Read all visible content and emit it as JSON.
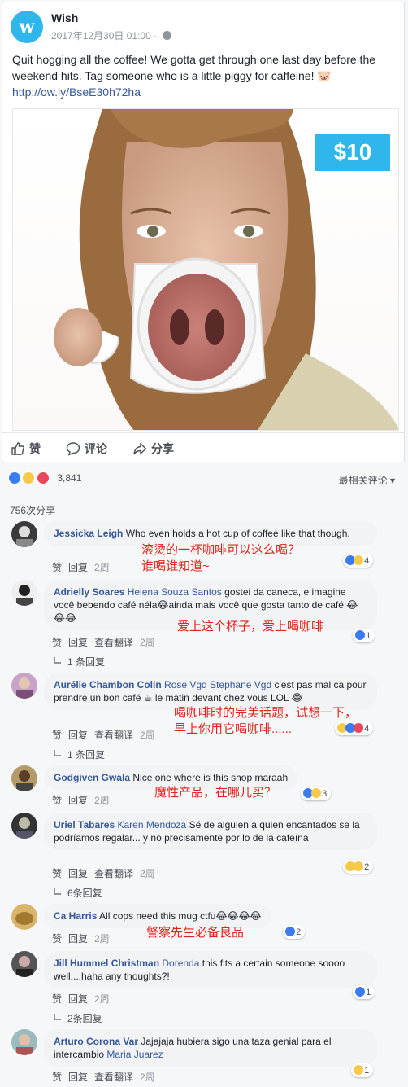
{
  "post": {
    "page_name": "Wish",
    "date": "2017年12月30日 01:00 · ",
    "text": "Quit hogging all the coffee! We gotta get through one last day before the weekend hits. Tag someone who is a little piggy for caffeine! 🐷",
    "link": "http://ow.ly/BseE30h72ha",
    "price_badge": "$10",
    "actions": {
      "like": "赞",
      "comment": "评论",
      "share": "分享"
    }
  },
  "reactions_count": "3,841",
  "sort_label": "最相关评论 ▾",
  "share_count": "756次分享",
  "comments": [
    {
      "author": "Jessicka Leigh",
      "text": "Who even holds a hot cup of coffee like that though.",
      "meta_like": "赞",
      "meta_reply": "回复",
      "time": "2周",
      "reactions": "4",
      "annotation": "滚烫的一杯咖啡可以这么喝？\n谁喝谁知道~"
    },
    {
      "author": "Adrielly Soares",
      "tag": "Helena Souza Santos",
      "text": " gostei da caneca, e imagine você bebendo café néla😂ainda mais você que gosta tanto de café 😂😂😂",
      "meta_like": "赞",
      "meta_reply": "回复",
      "meta_translate": "查看翻译",
      "time": "2周",
      "reactions": "1",
      "replies": "1 条回复",
      "annotation": "爱上这个杯子，爱上喝咖啡"
    },
    {
      "author": "Aurélie Chambon Colin",
      "tag": "Rose Vgd Stephane Vgd",
      "text": " c'est pas mal ca pour prendre un bon café ☕ le matin devant chez vous LOL 😂",
      "meta_like": "赞",
      "meta_reply": "回复",
      "meta_translate": "查看翻译",
      "time": "2周",
      "reactions": "4",
      "replies": "1 条回复",
      "annotation": "喝咖啡时的完美话题，试想一下，\n早上你用它喝咖啡......"
    },
    {
      "author": "Godgiven Gwala",
      "text": "Nice one where is this shop maraah",
      "meta_like": "赞",
      "meta_reply": "回复",
      "time": "2周",
      "reactions": "3",
      "annotation": "魔性产品，在哪儿买？"
    },
    {
      "author": "Uriel Tabares",
      "tag": "Karen Mendoza",
      "text": " Sé de alguien a quien encantados se la podríamos regalar... y no precisamente por lo de la cafeína",
      "meta_like": "赞",
      "meta_reply": "回复",
      "meta_translate": "查看翻译",
      "time": "2周",
      "reactions": "2",
      "replies": "6条回复"
    },
    {
      "author": "Ca Harris",
      "text": "All cops need this mug ctfu😂😂😂😂",
      "meta_like": "赞",
      "meta_reply": "回复",
      "time": "2周",
      "reactions": "2",
      "annotation": "警察先生必备良品"
    },
    {
      "author": "Jill Hummel Christman",
      "tag": "Dorenda",
      "text": " this fits a certain someone soooo well....haha any thoughts?!",
      "meta_like": "赞",
      "meta_reply": "回复",
      "time": "2周",
      "reactions": "1",
      "replies": "2条回复"
    },
    {
      "author": "Arturo Corona Var",
      "text": "Jajajaja hubiera sigo una taza genial para el intercambio ",
      "tag2": "Maria Juarez",
      "meta_like": "赞",
      "meta_reply": "回复",
      "meta_translate": "查看翻译",
      "time": "2周",
      "reactions": "1"
    }
  ],
  "colors": {
    "brand": "#2fb7ec",
    "link": "#365899",
    "annotation": "#e2231a"
  }
}
